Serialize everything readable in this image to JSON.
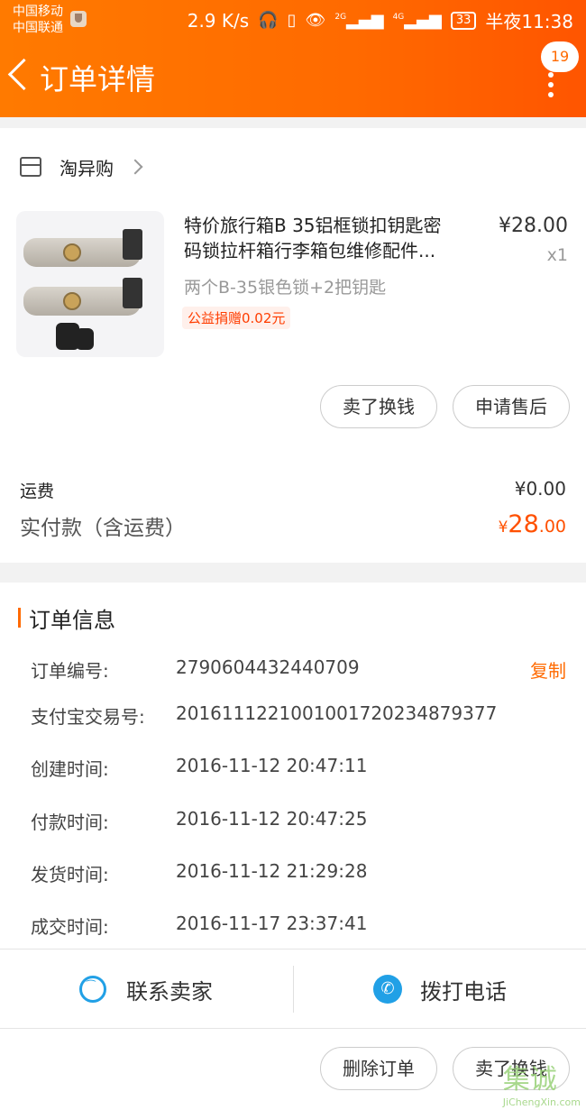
{
  "status_bar": {
    "carrier1": "中国移动",
    "carrier2": "中国联通",
    "speed": "2.9 K/s",
    "net1": "2G",
    "net2": "4G",
    "battery": "33",
    "time": "半夜11:38"
  },
  "nav": {
    "title": "订单详情",
    "badge_count": "19"
  },
  "shop": {
    "name": "淘异购"
  },
  "product": {
    "title_line1": "特价旅行箱B 35铝框锁扣钥匙密",
    "title_line2": "码锁拉杆箱行李箱包维修配件...",
    "price": "¥28.00",
    "qty": "x1",
    "spec": "两个B-35银色锁+2把钥匙",
    "charity": "公益捐赠0.02元"
  },
  "item_actions": {
    "sell_btn": "卖了换钱",
    "aftersale_btn": "申请售后"
  },
  "totals": {
    "shipping_label": "运费",
    "shipping_value": "¥0.00",
    "paid_label": "实付款（含运费）",
    "paid_symbol": "¥",
    "paid_int": "28",
    "paid_dec": ".00"
  },
  "order_info": {
    "title": "订单信息",
    "copy_label": "复制",
    "rows": [
      {
        "key": "订单编号:",
        "value": "2790604432440709"
      },
      {
        "key": "支付宝交易号:",
        "value": "2016111221001001720234879377"
      },
      {
        "key": "创建时间:",
        "value": "2016-11-12 20:47:11"
      },
      {
        "key": "付款时间:",
        "value": "2016-11-12 20:47:25"
      },
      {
        "key": "发货时间:",
        "value": "2016-11-12 21:29:28"
      },
      {
        "key": "成交时间:",
        "value": "2016-11-17 23:37:41"
      }
    ]
  },
  "contact": {
    "seller": "联系卖家",
    "call": "拨打电话"
  },
  "bottom_actions": {
    "delete": "删除订单",
    "sell": "卖了换钱"
  },
  "watermark": {
    "brand": "集诚",
    "url": "JiChengXin.com"
  }
}
